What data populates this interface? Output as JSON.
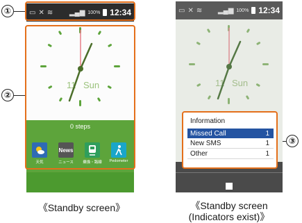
{
  "callouts": {
    "c1": "①",
    "c2": "②",
    "c3": "③"
  },
  "status": {
    "battery_pct": "100%",
    "time": "12:34"
  },
  "clock": {
    "date_text": "11",
    "weekday_text": "Sun",
    "hour_hand_color": "#4b6e2a",
    "second_hand_color": "#e67f88"
  },
  "home": {
    "steps": "0 steps",
    "apps": [
      {
        "label": "天気",
        "tile": "",
        "icon": "weather-icon",
        "color": "#2f6bb4"
      },
      {
        "label": "ニュース",
        "tile": "News",
        "icon": "news-icon",
        "color": "#555555"
      },
      {
        "label": "乗換・路線",
        "tile": "",
        "icon": "train-icon",
        "color": "#2f9e5c"
      },
      {
        "label": "Pedometer",
        "tile": "",
        "icon": "pedometer-icon",
        "color": "#1aa6c9"
      }
    ]
  },
  "info": {
    "title": "Information",
    "rows": [
      {
        "label": "Missed Call",
        "count": "1"
      },
      {
        "label": "New SMS",
        "count": "1"
      },
      {
        "label": "Other",
        "count": "1"
      }
    ]
  },
  "captions": {
    "left": "《Standby screen》",
    "right_line1": "《Standby screen",
    "right_line2": "(Indicators exist)》"
  },
  "colors": {
    "highlight": "#e46f1a",
    "selected": "#2454a2",
    "green": "#5da43b"
  }
}
